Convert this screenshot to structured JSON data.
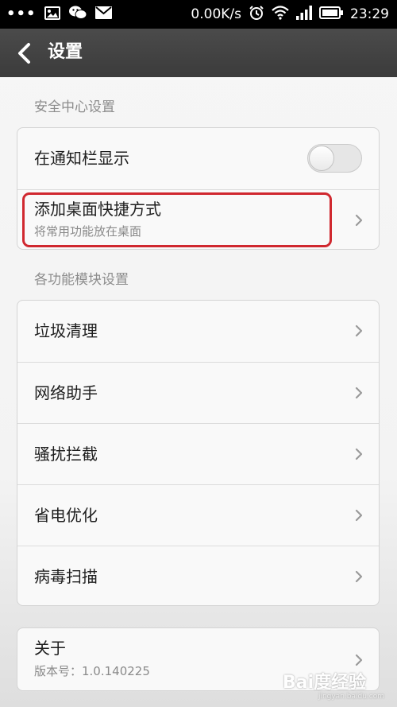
{
  "status_bar": {
    "network_speed": "0.00K/s",
    "time": "23:29",
    "icons": [
      "more-dots-icon",
      "image-icon",
      "wechat-icon",
      "mail-icon",
      "alarm-clock-icon",
      "wifi-icon",
      "signal-icon",
      "battery-icon"
    ]
  },
  "header": {
    "title": "设置",
    "back_icon": "chevron-left-icon"
  },
  "sections": {
    "security_label": "安全中心设置",
    "modules_label": "各功能模块设置"
  },
  "security_items": [
    {
      "title": "在通知栏显示",
      "toggle_on": false
    },
    {
      "title": "添加桌面快捷方式",
      "subtitle": "将常用功能放在桌面"
    }
  ],
  "module_items": [
    {
      "title": "垃圾清理"
    },
    {
      "title": "网络助手"
    },
    {
      "title": "骚扰拦截"
    },
    {
      "title": "省电优化"
    },
    {
      "title": "病毒扫描"
    }
  ],
  "about": {
    "title": "关于",
    "version": "版本号：1.0.140225"
  },
  "colors": {
    "highlight_border": "#d0282f",
    "title_bar": "#424242"
  },
  "watermark": {
    "main": "Bai度经验",
    "sub": "jingyan.baidu.com"
  }
}
